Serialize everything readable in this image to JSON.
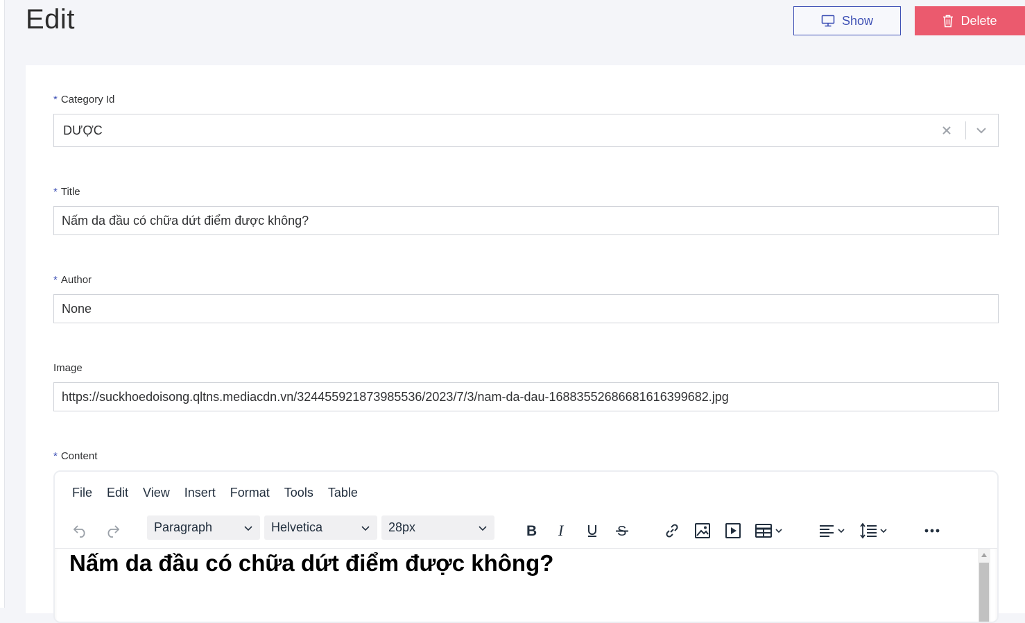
{
  "page": {
    "title": "Edit"
  },
  "actions": {
    "show_label": "Show",
    "delete_label": "Delete",
    "show_icon": "monitor-icon",
    "delete_icon": "trash-icon"
  },
  "form": {
    "category": {
      "label": "Category Id",
      "required": "*",
      "value": "DƯỢC"
    },
    "title": {
      "label": "Title",
      "required": "*",
      "value": "Nấm da đầu có chữa dứt điểm được không?"
    },
    "author": {
      "label": "Author",
      "required": "*",
      "value": "None"
    },
    "image": {
      "label": "Image",
      "value": "https://suckhoedoisong.qltns.mediacdn.vn/324455921873985536/2023/7/3/nam-da-dau-16883552686681616399682.jpg"
    },
    "content": {
      "label": "Content",
      "required": "*"
    }
  },
  "editor": {
    "menu": [
      "File",
      "Edit",
      "View",
      "Insert",
      "Format",
      "Tools",
      "Table"
    ],
    "block_format": "Paragraph",
    "font_family": "Helvetica",
    "font_size": "28px",
    "heading": "Nấm da đầu có chữa dứt điểm được không?"
  },
  "colors": {
    "accent": "#3f51b5",
    "danger": "#eb5a6e",
    "background": "#f4f5f9"
  }
}
